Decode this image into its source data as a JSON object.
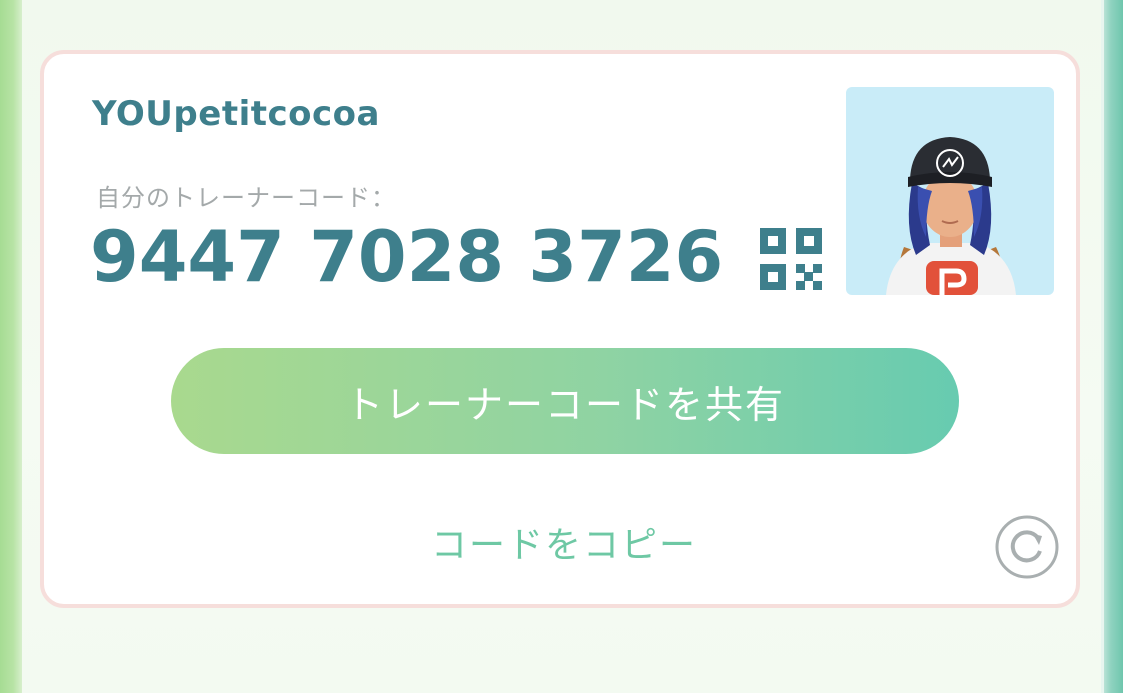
{
  "profile": {
    "name": "YOUpetitcocoa",
    "code_label": "自分のトレーナーコード：",
    "code": "9447 7028 3726"
  },
  "actions": {
    "share_label": "トレーナーコードを共有",
    "copy_label": "コードをコピー"
  },
  "icons": {
    "qr": "qr-code-icon",
    "refresh": "refresh-icon",
    "avatar": "trainer-avatar"
  },
  "colors": {
    "accent": "#3e7f8c",
    "copy_text": "#6ec8a4",
    "button_gradient_start": "#a9d98e",
    "button_gradient_end": "#67cbb0",
    "card_border": "#f6dedb",
    "avatar_bg": "#c9ecf8"
  }
}
